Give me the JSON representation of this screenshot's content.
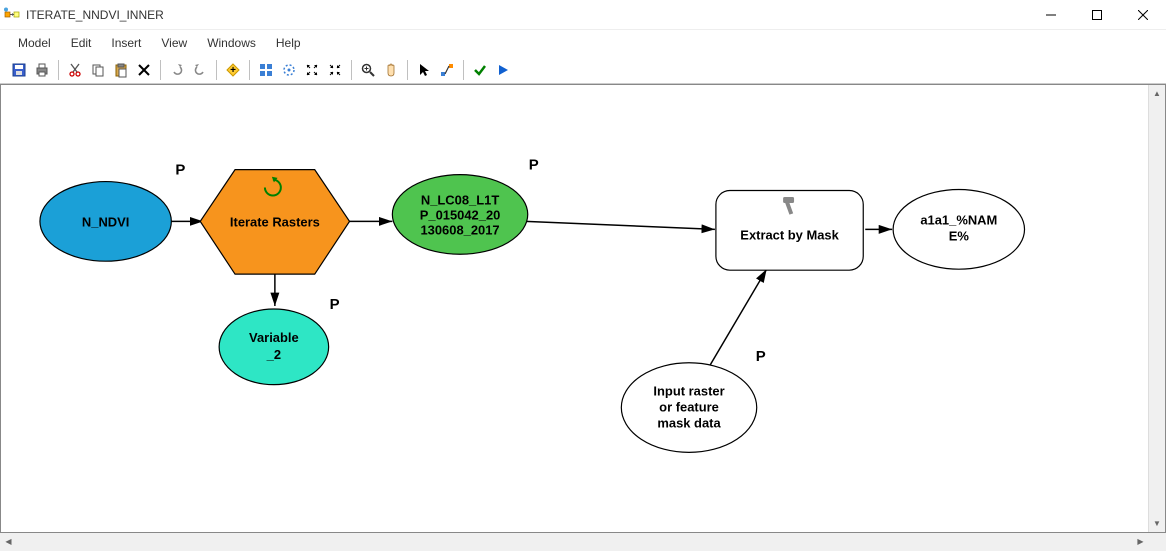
{
  "window": {
    "title": "ITERATE_NNDVI_INNER"
  },
  "menu": {
    "items": [
      "Model",
      "Edit",
      "Insert",
      "View",
      "Windows",
      "Help"
    ]
  },
  "toolbar": {
    "icons": [
      "save",
      "print",
      "cut",
      "copy",
      "paste",
      "delete",
      "undo",
      "redo",
      "add-data",
      "auto-layout",
      "full-extent",
      "fixed-zoom-in",
      "fixed-zoom-out",
      "zoom",
      "pan",
      "select",
      "connect",
      "validate",
      "run"
    ]
  },
  "nodes": {
    "n_ndvi": {
      "label": "N_NDVI",
      "param_flag": "P"
    },
    "iterate_rasters": {
      "label": "Iterate Rasters"
    },
    "n_lc08": {
      "line1": "N_LC08_L1T",
      "line2": "P_015042_20",
      "line3": "130608_2017",
      "param_flag": "P"
    },
    "variable_2": {
      "line1": "Variable",
      "line2": "_2",
      "param_flag": "P"
    },
    "extract_by_mask": {
      "label": "Extract by Mask"
    },
    "input_mask": {
      "line1": "Input raster",
      "line2": "or feature",
      "line3": "mask data",
      "param_flag": "P"
    },
    "output": {
      "line1": "a1a1_%NAM",
      "line2": "E%"
    }
  }
}
